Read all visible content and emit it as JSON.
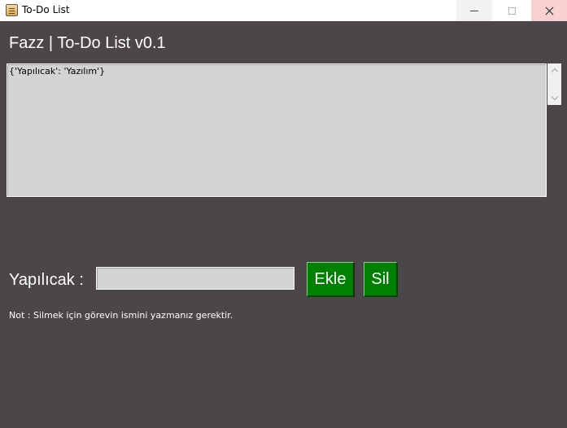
{
  "window": {
    "title": "To-Do List",
    "icon": "notepad-app-icon"
  },
  "header": {
    "title": "Fazz | To-Do List v0.1"
  },
  "list": {
    "content": "{'Yapılıcak': 'Yazılım'}"
  },
  "form": {
    "task_label": "Yapılıcak :",
    "task_value": "",
    "add_label": "Ekle",
    "delete_label": "Sil"
  },
  "footer": {
    "note": "Not : Silmek için görevin ismini yazmanız gerektir."
  },
  "colors": {
    "background": "#4b4649",
    "field": "#d3d3d3",
    "button": "#008000",
    "text": "#ffffff"
  }
}
